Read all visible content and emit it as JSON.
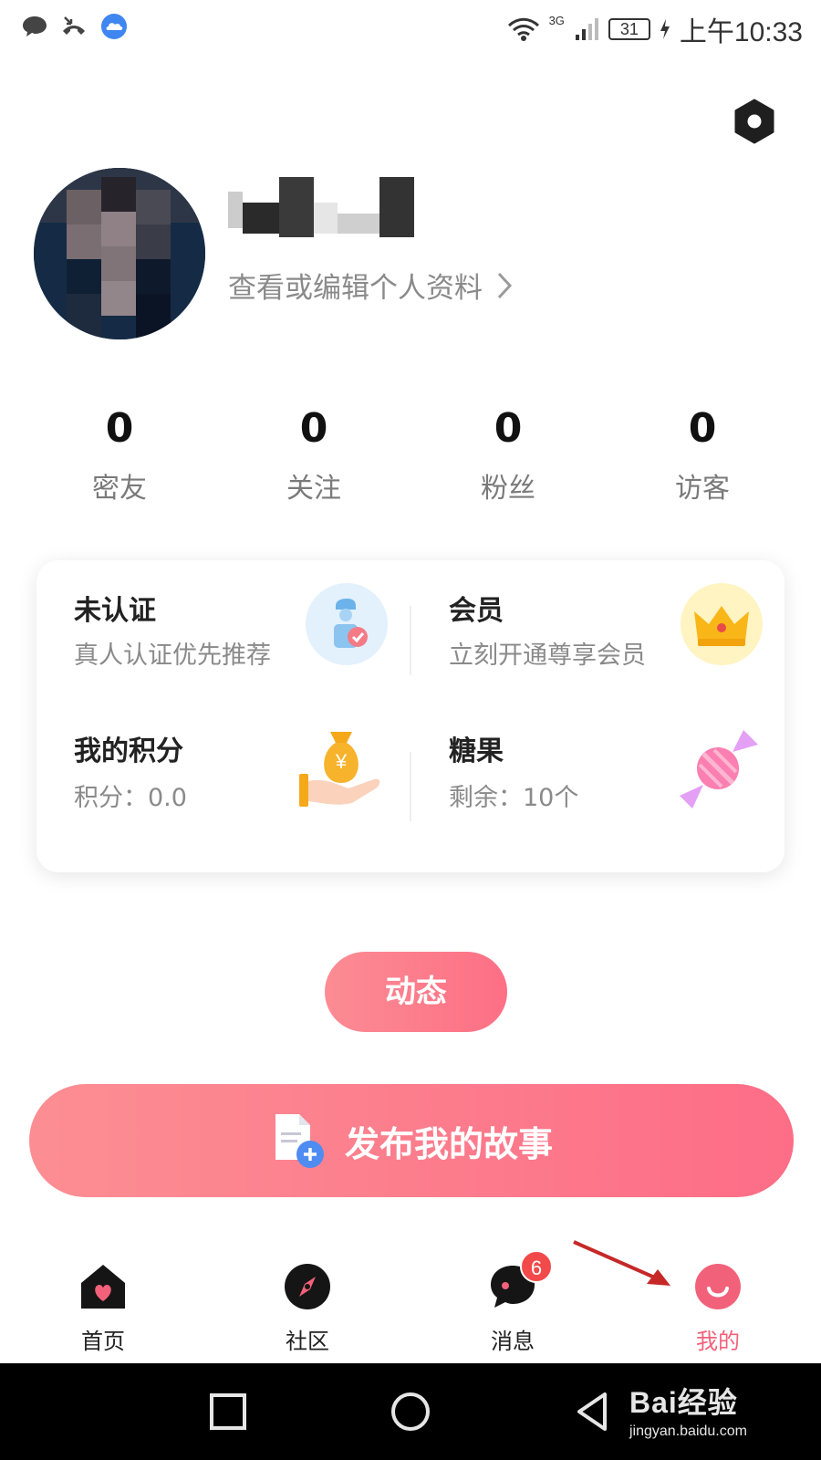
{
  "status_bar": {
    "network": "3G",
    "battery": "31",
    "time": "上午10:33"
  },
  "profile": {
    "edit_link": "查看或编辑个人资料"
  },
  "stats": [
    {
      "count": "0",
      "label": "密友"
    },
    {
      "count": "0",
      "label": "关注"
    },
    {
      "count": "0",
      "label": "粉丝"
    },
    {
      "count": "0",
      "label": "访客"
    }
  ],
  "cards": {
    "verify": {
      "title": "未认证",
      "subtitle": "真人认证优先推荐"
    },
    "vip": {
      "title": "会员",
      "subtitle": "立刻开通尊享会员"
    },
    "points": {
      "title": "我的积分",
      "subtitle": "积分：0.0"
    },
    "candy": {
      "title": "糖果",
      "subtitle": "剩余：10个"
    }
  },
  "buttons": {
    "dynamic": "动态",
    "publish": "发布我的故事"
  },
  "tab_bar": {
    "items": [
      {
        "label": "首页",
        "icon": "home-heart-icon"
      },
      {
        "label": "社区",
        "icon": "compass-icon"
      },
      {
        "label": "消息",
        "icon": "chat-bubble-icon",
        "badge": "6"
      },
      {
        "label": "我的",
        "icon": "smile-face-icon"
      }
    ],
    "active_color": "#f2617a"
  },
  "watermark": {
    "brand": "Bai经验",
    "url": "jingyan.baidu.com"
  }
}
